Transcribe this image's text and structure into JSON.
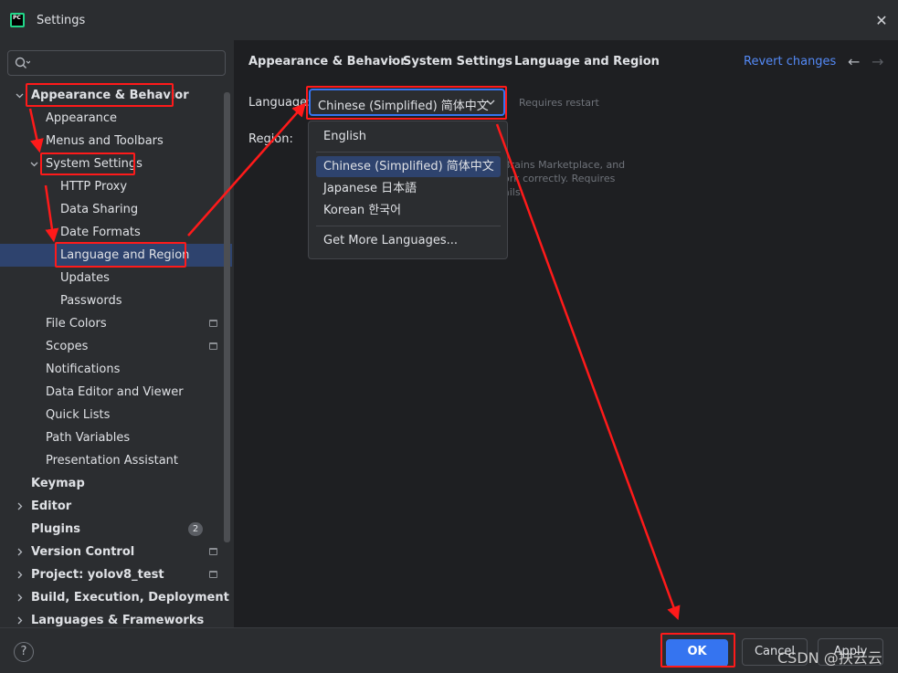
{
  "window": {
    "title": "Settings",
    "app_icon_text": "PC",
    "close_glyph": "✕"
  },
  "search": {
    "placeholder": ""
  },
  "sidebar": {
    "items": [
      {
        "label": "Appearance & Behavior"
      },
      {
        "label": "Appearance"
      },
      {
        "label": "Menus and Toolbars"
      },
      {
        "label": "System Settings"
      },
      {
        "label": "HTTP Proxy"
      },
      {
        "label": "Data Sharing"
      },
      {
        "label": "Date Formats"
      },
      {
        "label": "Language and Region"
      },
      {
        "label": "Updates"
      },
      {
        "label": "Passwords"
      },
      {
        "label": "File Colors"
      },
      {
        "label": "Scopes"
      },
      {
        "label": "Notifications"
      },
      {
        "label": "Data Editor and Viewer"
      },
      {
        "label": "Quick Lists"
      },
      {
        "label": "Path Variables"
      },
      {
        "label": "Presentation Assistant"
      },
      {
        "label": "Keymap"
      },
      {
        "label": "Editor"
      },
      {
        "label": "Plugins",
        "badge": "2"
      },
      {
        "label": "Version Control"
      },
      {
        "label": "Project: yolov8_test"
      },
      {
        "label": "Build, Execution, Deployment"
      },
      {
        "label": "Languages & Frameworks"
      }
    ]
  },
  "breadcrumb": [
    "Appearance & Behavior",
    "System Settings",
    "Language and Region"
  ],
  "breadcrumb_sep": "›",
  "header": {
    "revert": "Revert changes",
    "back_glyph": "←",
    "forward_glyph": "→"
  },
  "language": {
    "label": "Language:",
    "value": "Chinese (Simplified) 简体中文",
    "note": "Requires restart",
    "options": [
      "English",
      "Chinese (Simplified) 简体中文",
      "Japanese 日本語",
      "Korean 한국어",
      "Get More Languages..."
    ]
  },
  "region": {
    "label": "Region:",
    "hint_lines": [
      "Brains Marketplace, and",
      "ork correctly. Requires",
      "ails."
    ]
  },
  "footer": {
    "help": "?",
    "ok": "OK",
    "cancel": "Cancel",
    "apply": "Apply"
  },
  "watermark": "CSDN @扶云云",
  "colors": {
    "accent": "#3574f0",
    "annotation": "#ff1a1a",
    "selection": "#2e436e"
  }
}
